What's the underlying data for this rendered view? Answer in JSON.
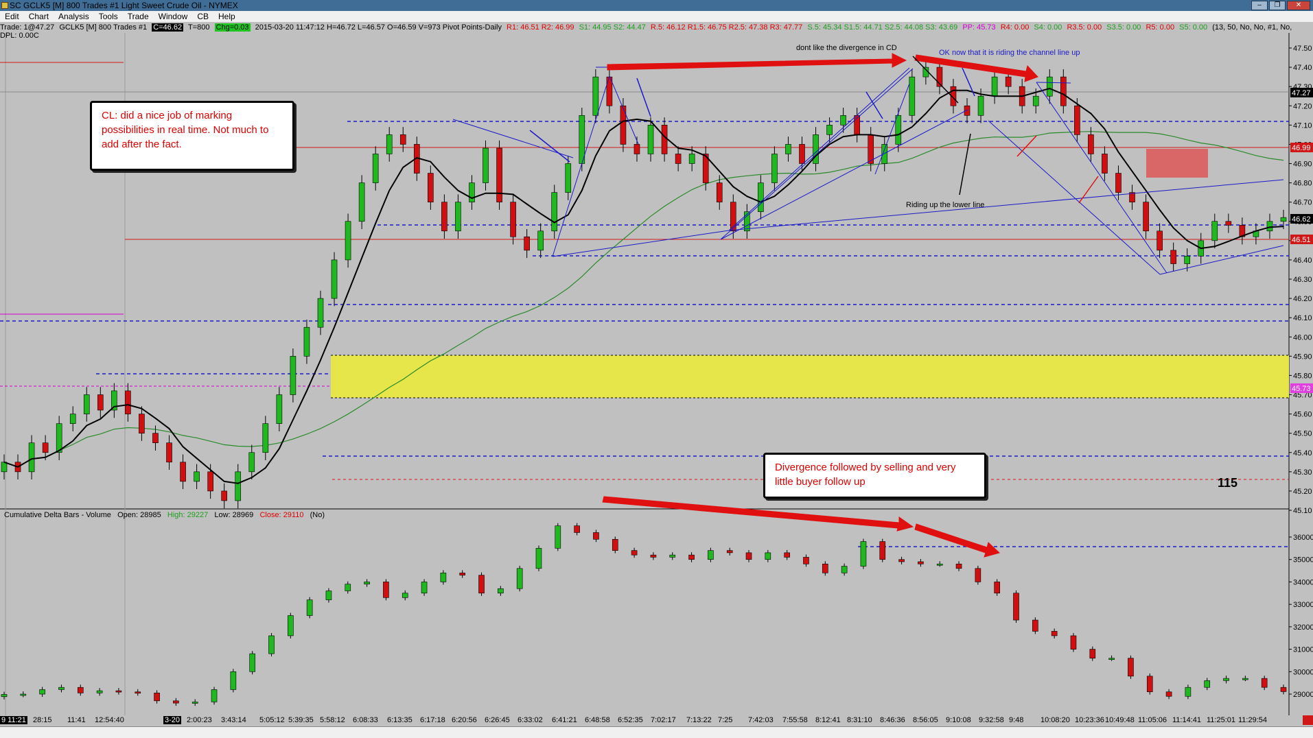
{
  "window": {
    "title": "SC GCLK5 [M]  800 Trades  #1  Light Sweet Crude Oil - NYMEX",
    "buttons": [
      "–",
      "❐",
      "✕"
    ]
  },
  "menu": [
    "Edit",
    "Chart",
    "Analysis",
    "Tools",
    "Trade",
    "Window",
    "CB",
    "Help"
  ],
  "header": {
    "trade": "Trade: 1@47.27",
    "symbol": "GCLK5 [M]  800 Trades  #1",
    "last": "C=46.62",
    "t": "T=800",
    "chg": "Chg=0.03",
    "ohlc": "2015-03-20 11:47:12 H=46.72 L=46.57 O=46.59 V=973 Pivot Points-Daily",
    "pivots_red": "R1: 46.51  R2: 46.99",
    "pivots_green": "S1: 44.95  S2: 44.47",
    "pivots_red2": "R.5: 46.12  R1.5: 46.75  R2.5: 47.38  R3: 47.77",
    "pivots_green2": "S.5: 45.34  S1.5: 44.71  S2.5: 44.08  S3: 43.69",
    "pp": "PP: 45.73",
    "pivots_red3": "R4: 0.00",
    "pivots_green3": "S4: 0.00",
    "pivots_red4": "R3.5: 0.00",
    "pivots_green4": "S3.5: 0.00",
    "pivots_red5": "R5: 0.00",
    "pivots_green5": "S5: 0.00",
    "tail": "(13, 50, No, No, #1, No,",
    "dpl": "DPL: 0.00C"
  },
  "notes": {
    "cl_note": "CL:  did a nice job of marking possibilities in real time.  Not much to add after the fact.",
    "divergence_note": "Divergence followed by selling and very little buyer follow up",
    "dont_like": "dont like the divergence in CD",
    "ok_now": "OK now that it is riding the channel line up",
    "riding_lower": "Riding up the lower line",
    "big_number": "115"
  },
  "lower_pane": {
    "title": "Cumulative Delta Bars - Volume",
    "open": "Open: 28985",
    "high": "High: 29227",
    "low": "Low: 28969",
    "close": "Close: 29110",
    "flag": "(No)"
  },
  "price_axis": [
    "47.50",
    "47.40",
    "47.30",
    "47.20",
    "47.10",
    "47.00",
    "46.90",
    "46.80",
    "46.70",
    "46.60",
    "46.50",
    "46.40",
    "46.30",
    "46.20",
    "46.10",
    "46.00",
    "45.90",
    "45.80",
    "45.70",
    "45.60",
    "45.50",
    "45.40",
    "45.30",
    "45.20",
    "45.10"
  ],
  "price_tags": {
    "last_black": "47.27",
    "red_high": "46.99",
    "current": "46.62",
    "red_low": "46.51",
    "pp_tag": "45.73"
  },
  "delta_axis": [
    "36000",
    "35000",
    "34000",
    "33000",
    "32000",
    "31000",
    "30000",
    "29000"
  ],
  "time_axis": [
    "9 11:21",
    "28:15",
    "11:41",
    "12:54:40",
    "3-20",
    "2:00:23",
    "3:43:14",
    "5:05:12",
    "5:39:35",
    "5:58:12",
    "6:08:33",
    "6:13:35",
    "6:17:18",
    "6:20:56",
    "6:26:45",
    "6:33:02",
    "6:41:21",
    "6:48:58",
    "6:52:35",
    "7:02:17",
    "7:13:22",
    "7:25",
    "7:42:03",
    "7:55:58",
    "8:12:41",
    "8:31:10",
    "8:46:36",
    "8:56:05",
    "9:10:08",
    "9:32:58",
    "9:48",
    "10:08:20",
    "10:23:36",
    "10:49:48",
    "11:05:06",
    "11:14:41",
    "11:25:01",
    "11:29:54"
  ],
  "colors": {
    "bull": "#1fb81f",
    "bear": "#d01010",
    "pivot_blue": "#1a1ac8",
    "pivot_red": "#d01818",
    "zone_yellow": "#e6e64a",
    "zone_red": "#e05050",
    "ma_black": "#000000",
    "ma_green": "#2a8a2a"
  },
  "chart_data": {
    "type": "candlestick",
    "price_series": [
      45.35,
      45.3,
      45.45,
      45.4,
      45.55,
      45.6,
      45.7,
      45.62,
      45.72,
      45.6,
      45.5,
      45.45,
      45.35,
      45.25,
      45.3,
      45.2,
      45.15,
      45.3,
      45.4,
      45.55,
      45.7,
      45.9,
      46.05,
      46.2,
      46.4,
      46.6,
      46.8,
      46.95,
      47.05,
      47.0,
      46.85,
      46.7,
      46.55,
      46.7,
      46.8,
      46.98,
      46.7,
      46.52,
      46.45,
      46.55,
      46.75,
      46.9,
      47.15,
      47.35,
      47.2,
      47.0,
      46.95,
      47.1,
      46.95,
      46.9,
      46.95,
      46.8,
      46.7,
      46.55,
      46.65,
      46.8,
      46.95,
      47.0,
      46.9,
      47.05,
      47.1,
      47.15,
      47.05,
      46.9,
      47.0,
      47.15,
      47.35,
      47.4,
      47.3,
      47.2,
      47.15,
      47.25,
      47.35,
      47.3,
      47.2,
      47.25,
      47.35,
      47.2,
      47.05,
      46.95,
      46.85,
      46.75,
      46.7,
      46.55,
      46.45,
      46.38,
      46.42,
      46.5,
      46.6,
      46.58,
      46.52,
      46.55,
      46.6,
      46.62
    ],
    "delta_series": [
      28985,
      29000,
      29200,
      29300,
      29050,
      29150,
      29100,
      29050,
      28700,
      28600,
      28650,
      29200,
      30000,
      30800,
      31600,
      32500,
      33200,
      33600,
      33900,
      34000,
      33300,
      33500,
      34000,
      34400,
      34300,
      33500,
      33700,
      34600,
      35500,
      36500,
      36200,
      35900,
      35400,
      35200,
      35100,
      35200,
      35000,
      35400,
      35300,
      35000,
      35300,
      35100,
      34800,
      34400,
      34700,
      35800,
      35000,
      34900,
      34800,
      34800,
      34600,
      34000,
      33500,
      32300,
      31800,
      31600,
      31000,
      30600,
      30600,
      29800,
      29100,
      28900,
      29300,
      29600,
      29700,
      29700,
      29300,
      29110
    ]
  }
}
